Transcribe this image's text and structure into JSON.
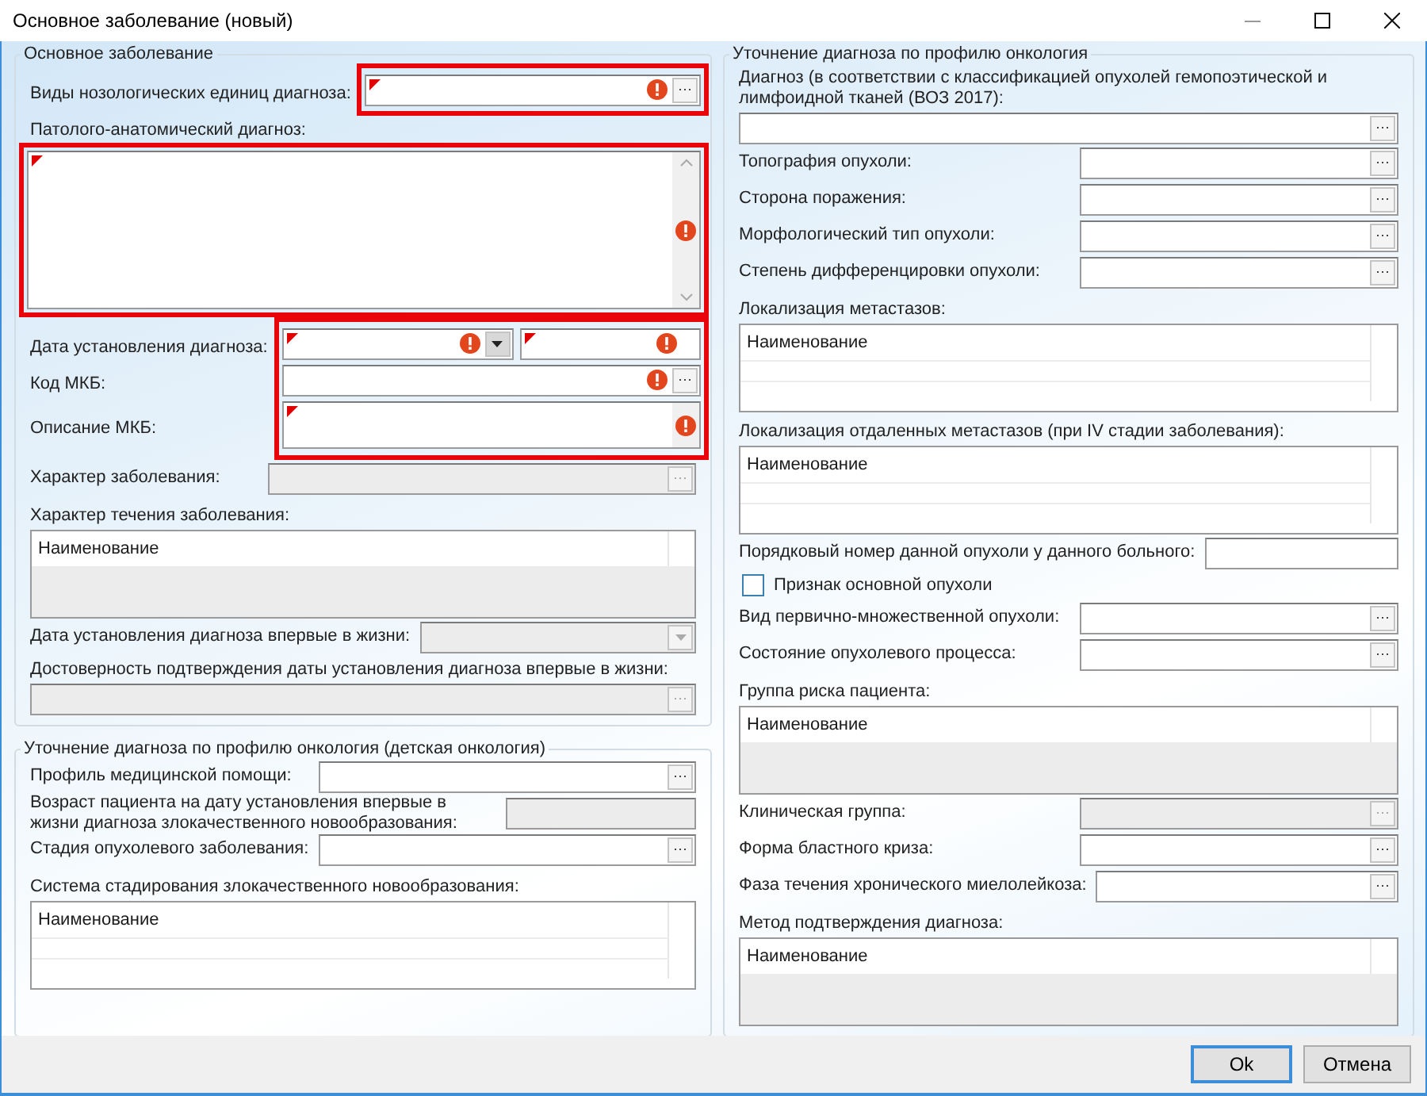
{
  "window": {
    "title": "Основное заболевание (новый)"
  },
  "columns": [
    {
      "groups": [
        {
          "title": "Основное заболевание",
          "fields": [
            {
              "kind": "lookup",
              "label": "Виды нозологических единиц диагноза:",
              "required": true,
              "error": true,
              "highlighted": true
            },
            {
              "kind": "memo_block",
              "label": "Патолого-анатомический диагноз:",
              "required": true,
              "error": true,
              "highlighted": true
            },
            {
              "kind": "datetime",
              "label": "Дата установления диагноза:",
              "required": true,
              "error": true,
              "highlighted": true
            },
            {
              "kind": "lookup",
              "label": "Код МКБ:",
              "error": true,
              "highlighted": true
            },
            {
              "kind": "memo",
              "label": "Описание МКБ:",
              "required": true,
              "error": true,
              "highlighted": true
            },
            {
              "kind": "lookup",
              "label": "Характер заболевания:",
              "disabled": true
            },
            {
              "kind": "grid",
              "label": "Характер течения заболевания:",
              "header": "Наименование",
              "disabled": true
            },
            {
              "kind": "combo",
              "label": "Дата установления диагноза впервые в жизни:",
              "disabled": true
            },
            {
              "kind": "lookup_block",
              "label": "Достоверность подтверждения даты установления диагноза впервые в жизни:",
              "disabled": true
            }
          ]
        },
        {
          "title": "Уточнение диагноза по профилю онкология (детская онкология)",
          "fields": [
            {
              "kind": "lookup",
              "label": "Профиль медицинской помощи:"
            },
            {
              "kind": "text",
              "label": "Возраст пациента на дату установления впервые в жизни диагноза злокачественного новообразования:",
              "disabled": true
            },
            {
              "kind": "lookup",
              "label": "Стадия опухолевого заболевания:"
            },
            {
              "kind": "grid",
              "label": "Система стадирования злокачественного новообразования:",
              "header": "Наименование"
            }
          ]
        }
      ]
    },
    {
      "groups": [
        {
          "title": "Уточнение диагноза по профилю онкология",
          "fields": [
            {
              "kind": "lookup_block",
              "label": "Диагноз (в соответствии с классификацией опухолей гемопоэтической и лимфоидной тканей (ВОЗ 2017):"
            },
            {
              "kind": "lookup",
              "label": "Топография опухоли:"
            },
            {
              "kind": "lookup",
              "label": "Сторона поражения:"
            },
            {
              "kind": "lookup",
              "label": "Морфологический тип опухоли:"
            },
            {
              "kind": "lookup",
              "label": "Степень дифференцировки опухоли:"
            },
            {
              "kind": "grid",
              "label": "Локализация метастазов:",
              "header": "Наименование"
            },
            {
              "kind": "grid",
              "label": "Локализация отдаленных метастазов (при IV стадии заболевания):",
              "header": "Наименование"
            },
            {
              "kind": "text",
              "label": "Порядковый номер данной опухоли у данного больного:"
            },
            {
              "kind": "checkbox",
              "label": "Признак основной опухоли",
              "checked": false
            },
            {
              "kind": "lookup",
              "label": "Вид первично-множественной опухоли:"
            },
            {
              "kind": "lookup",
              "label": "Состояние опухолевого процесса:"
            },
            {
              "kind": "grid",
              "label": "Группа риска пациента:",
              "header": "Наименование",
              "disabled": true
            },
            {
              "kind": "lookup",
              "label": "Клиническая группа:",
              "disabled": true
            },
            {
              "kind": "lookup",
              "label": "Форма бластного криза:"
            },
            {
              "kind": "lookup",
              "label": "Фаза течения хронического миелолейкоза:"
            },
            {
              "kind": "grid",
              "label": "Метод подтверждения диагноза:",
              "header": "Наименование",
              "disabled": true
            }
          ]
        }
      ]
    }
  ],
  "footer": {
    "buttons": [
      {
        "label": "Ok",
        "default": true
      },
      {
        "label": "Отмена",
        "default": false
      }
    ]
  }
}
